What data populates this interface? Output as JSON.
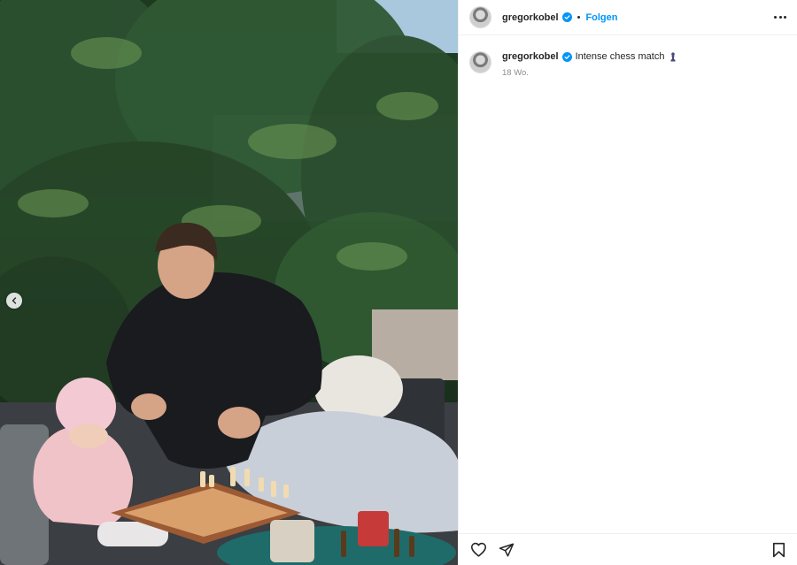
{
  "post": {
    "author": {
      "username": "gregorkobel",
      "verified": true,
      "avatar_icon": "avatar-icon"
    },
    "header": {
      "separator": "•",
      "follow_label": "Folgen",
      "more_icon": "more-horizontal-icon"
    },
    "caption": {
      "text": "Intense chess match",
      "emoji_icon": "chess-pawn-icon",
      "timestamp": "18 Wo."
    },
    "media": {
      "prev_icon": "chevron-left-icon"
    },
    "actions": {
      "like_icon": "heart-icon",
      "share_icon": "send-icon",
      "save_icon": "bookmark-icon"
    },
    "colors": {
      "accent": "#0095f6",
      "verified_badge": "#0095f6",
      "text": "#262626",
      "muted": "#8e8e8e"
    }
  }
}
